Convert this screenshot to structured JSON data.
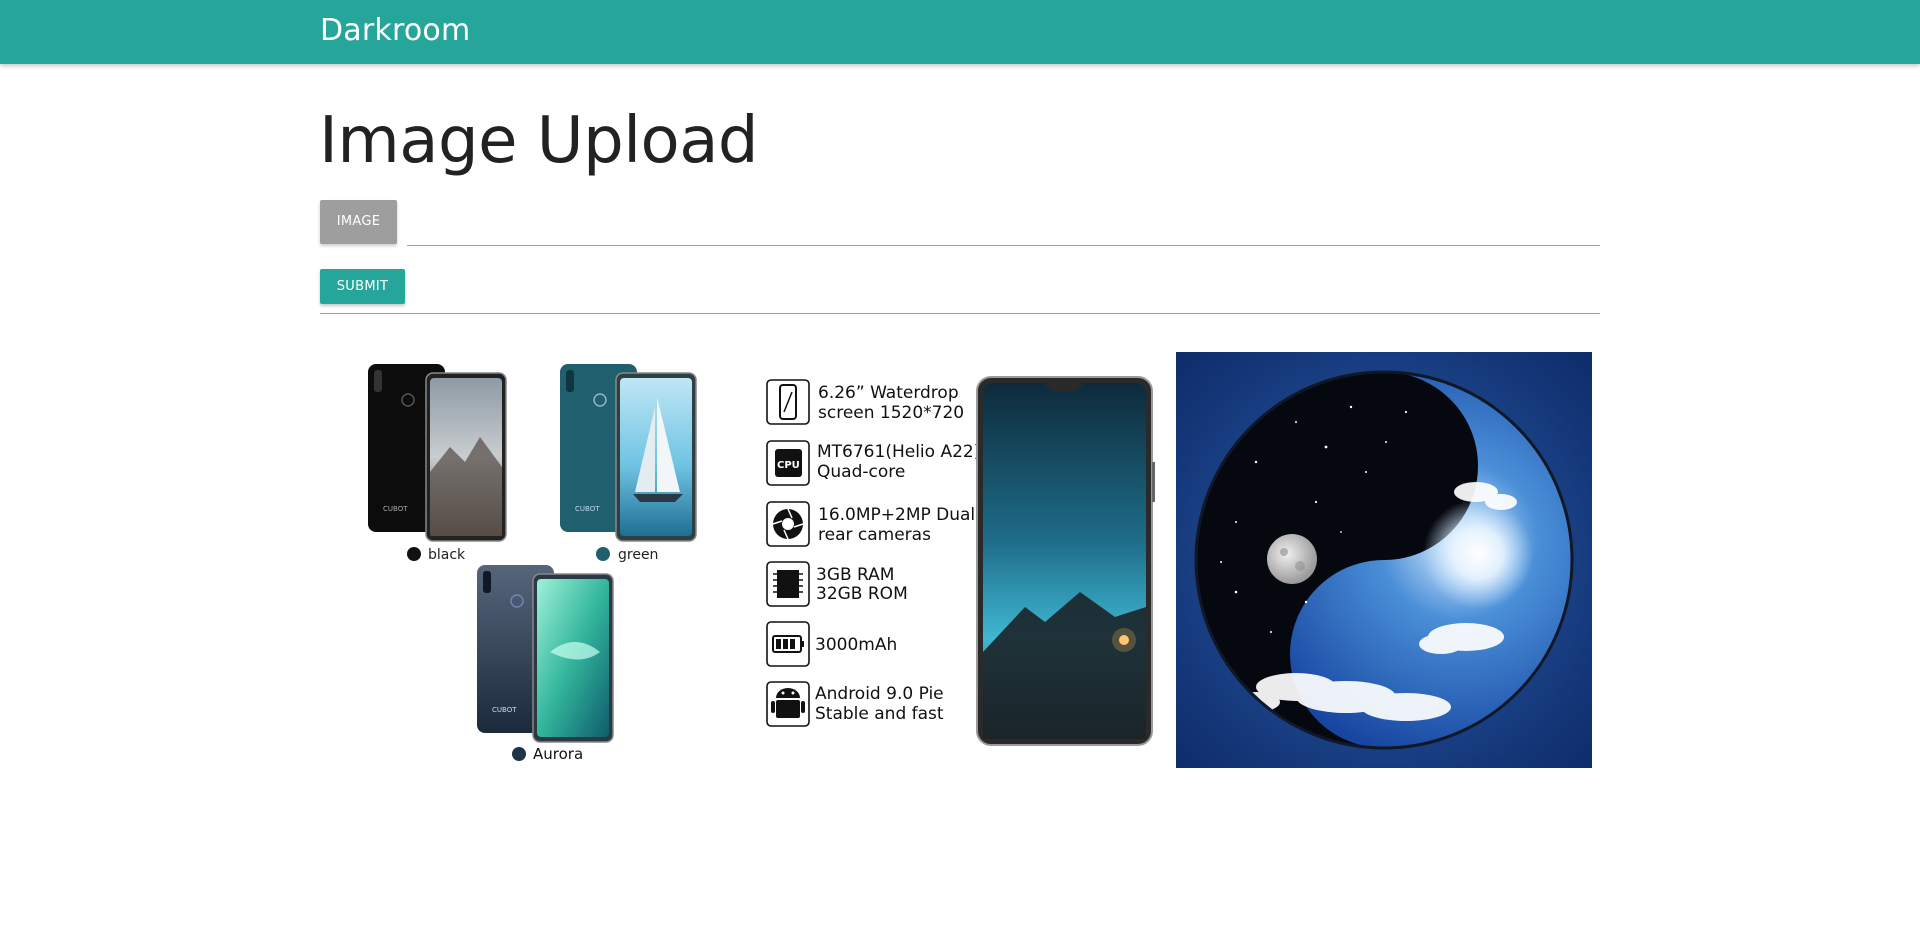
{
  "navbar": {
    "brand": "Darkroom"
  },
  "page": {
    "title": "Image Upload"
  },
  "form": {
    "file_button_label": "IMAGE",
    "file_path_value": "",
    "submit_label": "SUBMIT"
  },
  "product_image": {
    "colors": [
      {
        "name": "black",
        "swatch": "#111111"
      },
      {
        "name": "green",
        "swatch": "#1f5f6e"
      },
      {
        "name": "Aurora",
        "swatch": "#1d3347"
      }
    ],
    "phone_brand": "CUBOT",
    "specs": [
      {
        "icon": "screen-icon",
        "line1": "6.26”  Waterdrop",
        "line2": "screen 1520*720"
      },
      {
        "icon": "cpu-icon",
        "line1": "MT6761(Helio A22)",
        "line2": "Quad-core",
        "icon_text": "CPU"
      },
      {
        "icon": "camera-aperture-icon",
        "line1": "16.0MP+2MP Dual",
        "line2": "rear cameras"
      },
      {
        "icon": "memory-chip-icon",
        "line1": "3GB RAM",
        "line2": "32GB ROM"
      },
      {
        "icon": "battery-icon",
        "line1": "3000mAh",
        "line2": ""
      },
      {
        "icon": "android-icon",
        "line1": "Android 9.0 Pie",
        "line2": "Stable and fast"
      }
    ]
  },
  "colors": {
    "navbar": "#26a69a",
    "file_button": "#9e9e9e",
    "submit_button": "#26a69a"
  }
}
